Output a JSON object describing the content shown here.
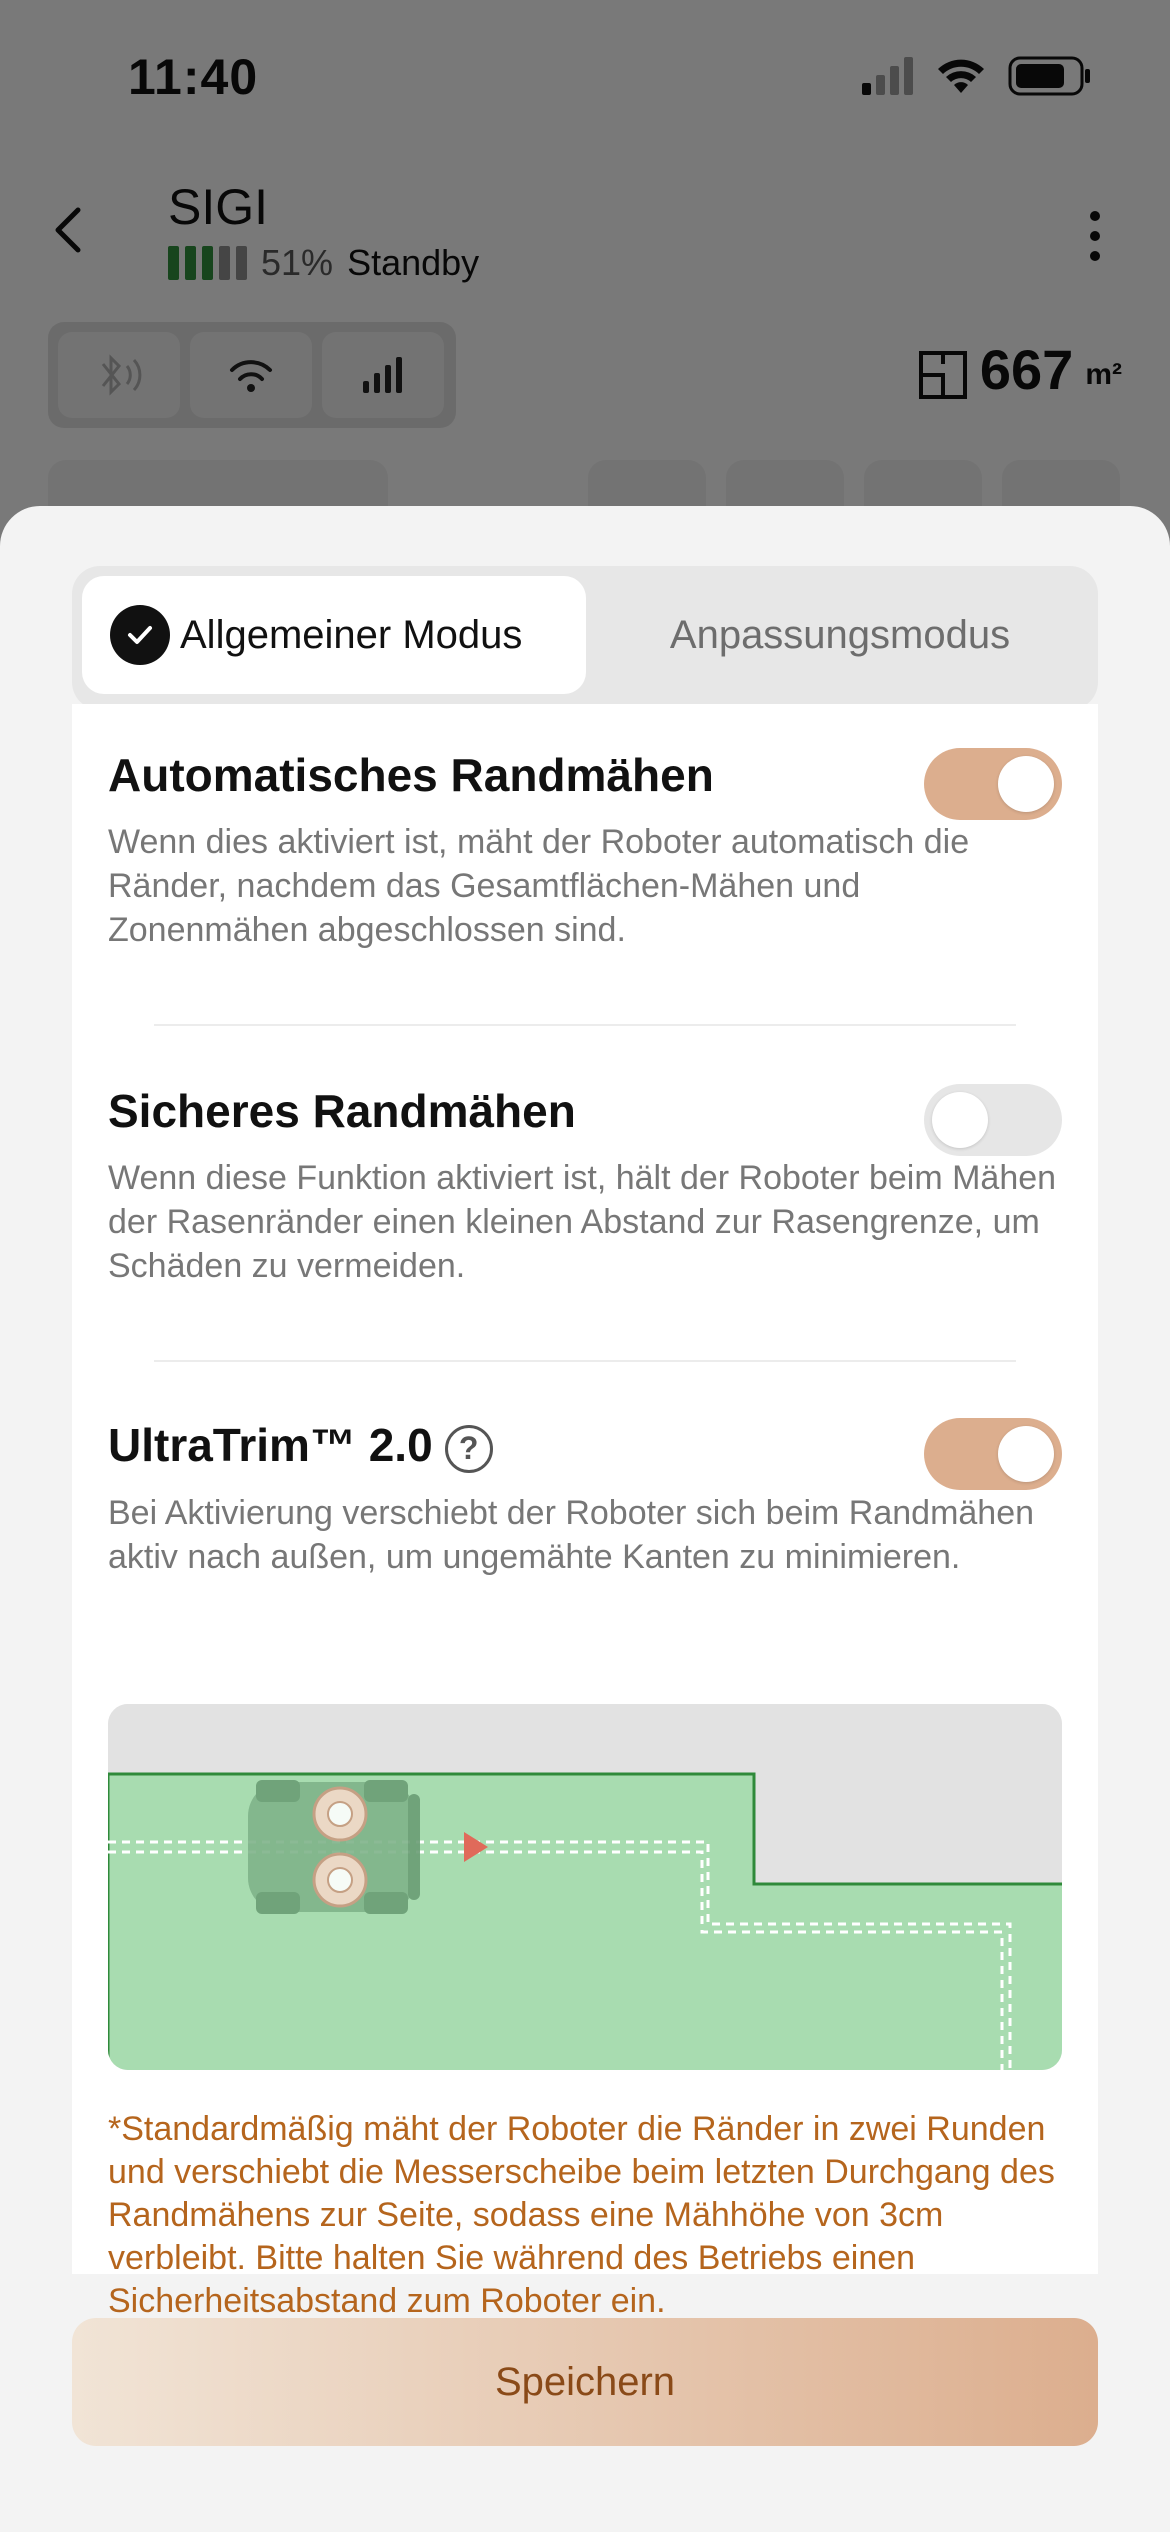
{
  "status_bar": {
    "time": "11:40"
  },
  "device": {
    "name": "SIGI",
    "battery_percent": "51%",
    "battery_level": 0.51,
    "state": "Standby"
  },
  "area": {
    "value": "667",
    "unit": "m²"
  },
  "tabs": [
    {
      "label": "Allgemeiner Modus",
      "active": true
    },
    {
      "label": "Anpassungsmodus",
      "active": false
    }
  ],
  "settings": {
    "auto_edge": {
      "title": "Automatisches Randmähen",
      "description": "Wenn dies aktiviert ist, mäht der Roboter automatisch die Ränder, nachdem das Gesamtflächen-Mähen und Zonenmähen abgeschlossen sind.",
      "enabled": true
    },
    "safe_edge": {
      "title": "Sicheres Randmähen",
      "description": "Wenn diese Funktion aktiviert ist, hält der Roboter beim Mähen der Rasenränder einen kleinen Abstand zur Rasengrenze, um Schäden zu vermeiden.",
      "enabled": false
    },
    "ultratrim": {
      "title": "UltraTrim™ 2.0",
      "help_icon": "?",
      "description": "Bei Aktivierung verschiebt der Roboter sich beim Randmähen aktiv nach außen, um ungemähte Kanten zu minimieren.",
      "enabled": true
    }
  },
  "note": "*Standardmäßig mäht der Roboter die Ränder in zwei Runden und verschiebt die Messerscheibe beim letzten Durchgang des Randmähens zur Seite, sodass eine Mähhöhe von 3cm verbleibt. Bitte halten Sie während des Betriebs einen Sicherheitsabstand zum Roboter ein.",
  "save_label": "Speichern",
  "colors": {
    "accent": "#dcae8e",
    "note_text": "#b5651d",
    "save_text": "#8a4a18",
    "lawn": "#a8dcb0",
    "lawn_border": "#2f8a3a"
  }
}
